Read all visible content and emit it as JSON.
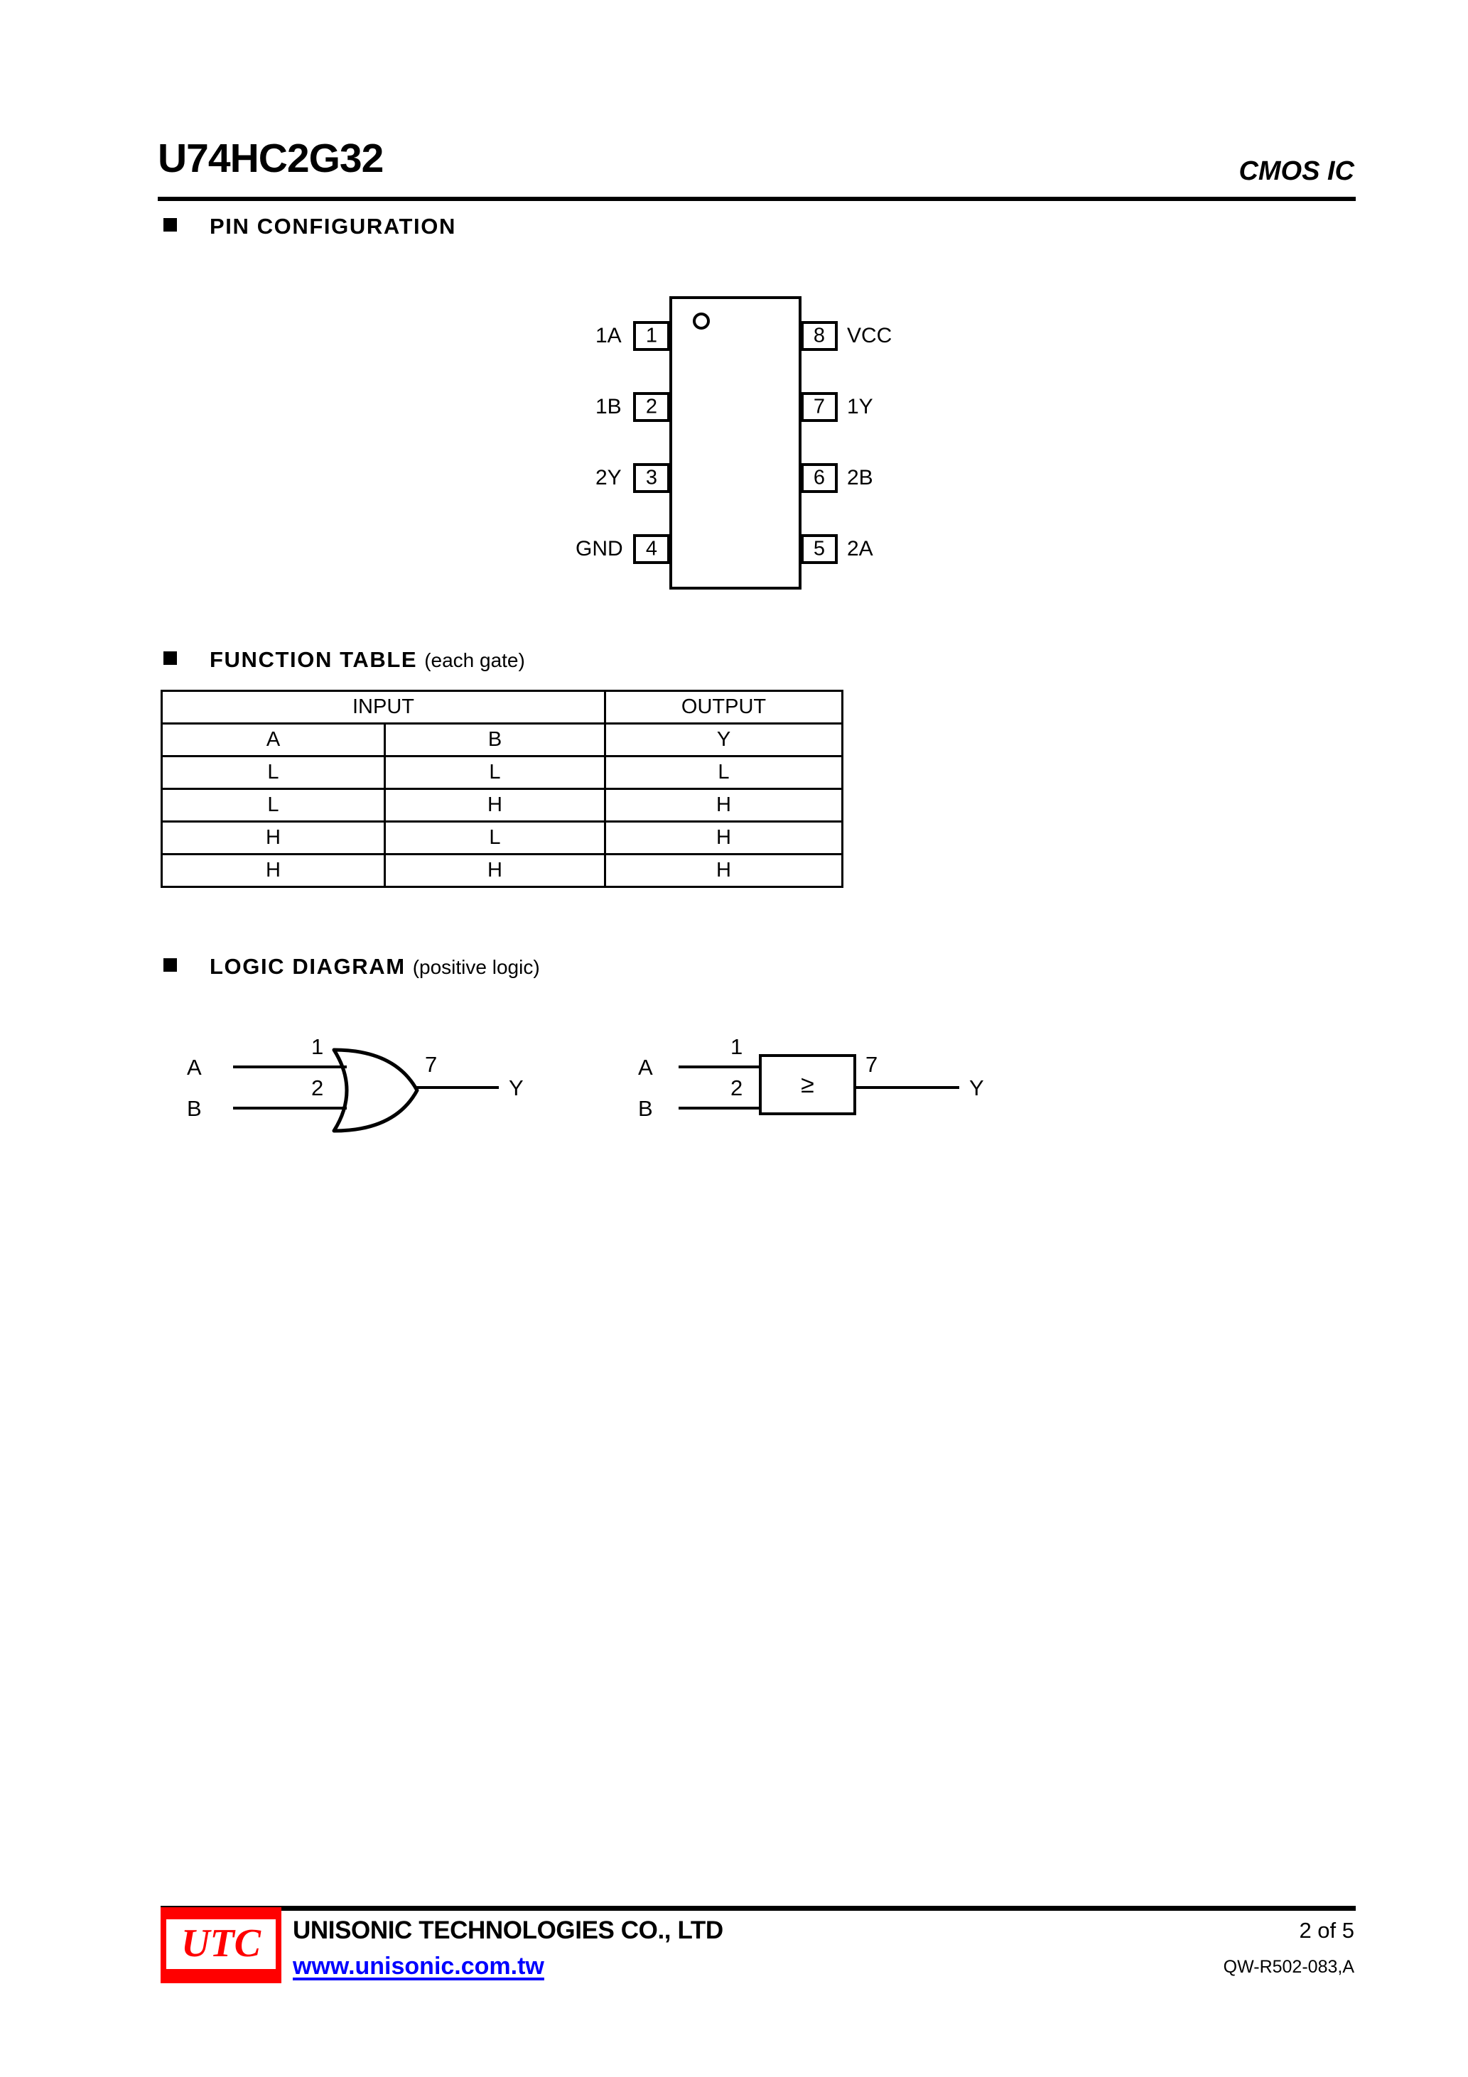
{
  "header": {
    "part_number": "U74HC2G32",
    "family": "CMOS IC"
  },
  "sections": {
    "pin_configuration": {
      "title": "PIN CONFIGURATION",
      "subtitle": ""
    },
    "function_table": {
      "title": "FUNCTION TABLE",
      "subtitle": "(each gate)"
    },
    "logic_diagram": {
      "title": "LOGIC DIAGRAM",
      "subtitle": "(positive logic)"
    }
  },
  "pin_configuration": {
    "left_pins": [
      {
        "number": "1",
        "label": "1A"
      },
      {
        "number": "2",
        "label": "1B"
      },
      {
        "number": "3",
        "label": "2Y"
      },
      {
        "number": "4",
        "label": "GND"
      }
    ],
    "right_pins": [
      {
        "number": "8",
        "label": "VCC"
      },
      {
        "number": "7",
        "label": "1Y"
      },
      {
        "number": "6",
        "label": "2B"
      },
      {
        "number": "5",
        "label": "2A"
      }
    ]
  },
  "function_table": {
    "group_headers": [
      {
        "label": "INPUT",
        "span": 2
      },
      {
        "label": "OUTPUT",
        "span": 1
      }
    ],
    "columns": [
      "A",
      "B",
      "Y"
    ],
    "rows": [
      [
        "L",
        "L",
        "L"
      ],
      [
        "L",
        "H",
        "H"
      ],
      [
        "H",
        "L",
        "H"
      ],
      [
        "H",
        "H",
        "H"
      ]
    ]
  },
  "logic_diagram": {
    "gate_distinctive": {
      "input_a_label": "A",
      "input_b_label": "B",
      "input_a_pin": "1",
      "input_b_pin": "2",
      "output_pin": "7",
      "output_label": "Y"
    },
    "gate_iec": {
      "input_a_label": "A",
      "input_b_label": "B",
      "input_a_pin": "1",
      "input_b_pin": "2",
      "output_pin": "7",
      "output_label": "Y",
      "symbol": "≥"
    }
  },
  "footer": {
    "logo_text": "UTC",
    "company": "UNISONIC TECHNOLOGIES CO., LTD",
    "website": "www.unisonic.com.tw",
    "page": "2 of 5",
    "doc_code": "QW-R502-083,A",
    "logo_color": "#ff0000",
    "link_color": "#0000ff"
  }
}
